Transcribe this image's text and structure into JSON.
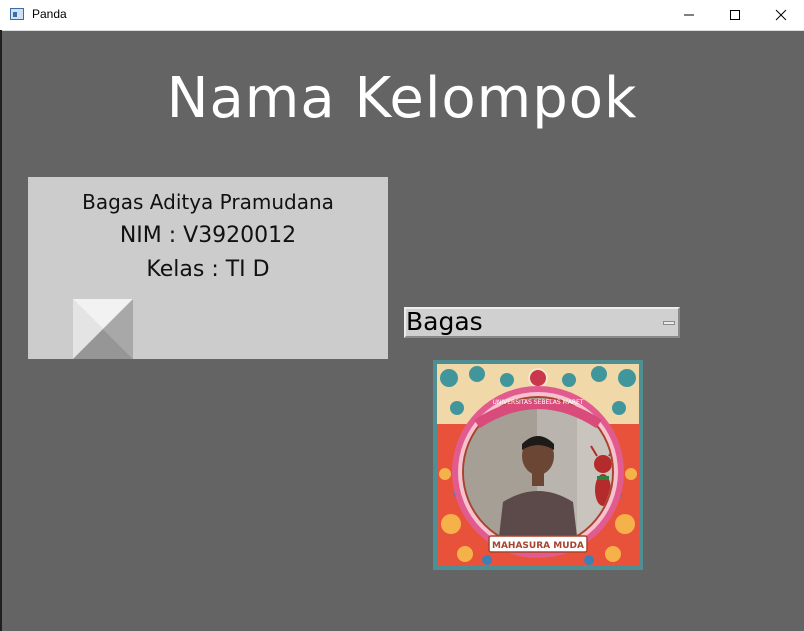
{
  "window": {
    "title": "Panda",
    "controls": [
      "minimize",
      "maximize",
      "close"
    ]
  },
  "heading": "Nama Kelompok",
  "info": {
    "name": "Bagas Aditya Pramudana",
    "nim": "NIM : V3920012",
    "kelas": "Kelas : TI D"
  },
  "dropdown": {
    "selected": "Bagas"
  },
  "photo": {
    "banner_text": "MAHASURA MUDA",
    "arc_text": "UNIVERSITAS SEBELAS MARET"
  },
  "colors": {
    "background": "#646464",
    "panel": "#cccccc",
    "frame": "#4f8f94"
  }
}
